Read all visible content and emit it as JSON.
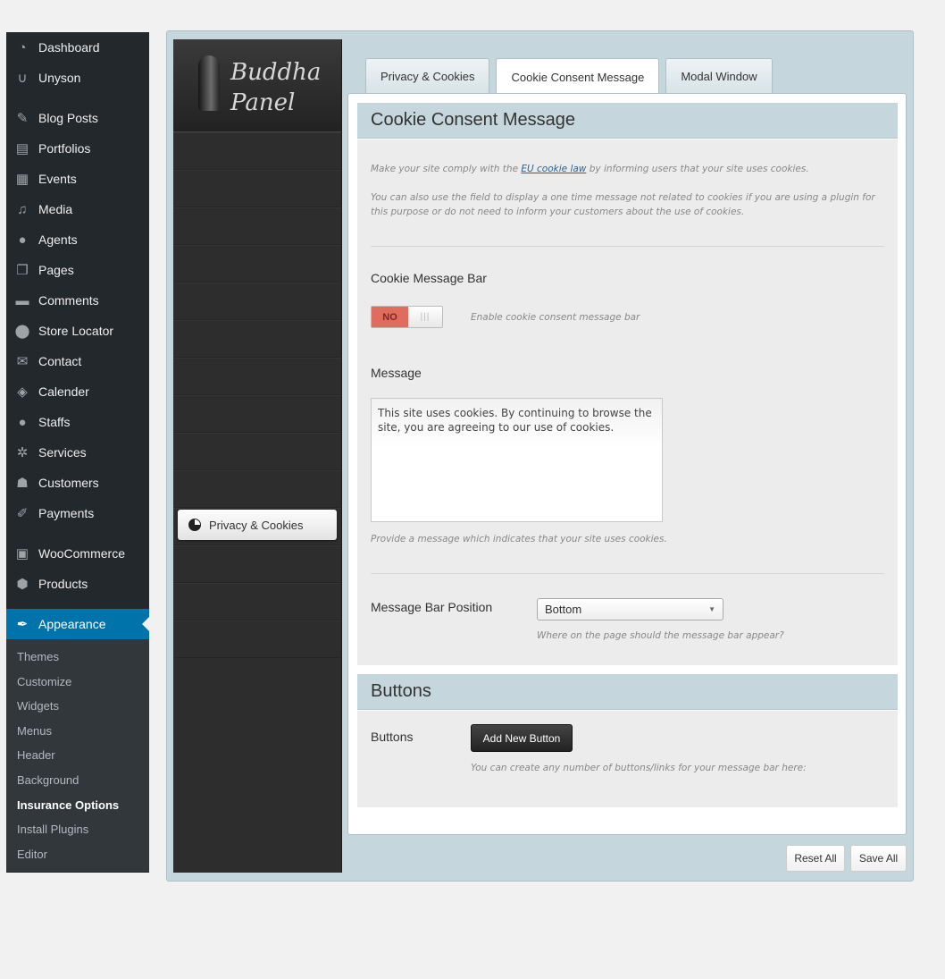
{
  "sidebar": {
    "items": [
      {
        "label": "Dashboard",
        "icon": "gauge-icon"
      },
      {
        "label": "Unyson",
        "icon": "unyson-icon"
      },
      {
        "label": "Blog Posts",
        "icon": "pin-icon"
      },
      {
        "label": "Portfolios",
        "icon": "portfolio-icon"
      },
      {
        "label": "Events",
        "icon": "calendar-icon"
      },
      {
        "label": "Media",
        "icon": "media-icon"
      },
      {
        "label": "Agents",
        "icon": "person-icon"
      },
      {
        "label": "Pages",
        "icon": "pages-icon"
      },
      {
        "label": "Comments",
        "icon": "comment-icon"
      },
      {
        "label": "Store Locator",
        "icon": "location-icon"
      },
      {
        "label": "Contact",
        "icon": "mail-icon"
      },
      {
        "label": "Calender",
        "icon": "tag-icon"
      },
      {
        "label": "Staffs",
        "icon": "person-icon"
      },
      {
        "label": "Services",
        "icon": "services-icon"
      },
      {
        "label": "Customers",
        "icon": "group-icon"
      },
      {
        "label": "Payments",
        "icon": "edit-icon"
      },
      {
        "label": "WooCommerce",
        "icon": "woo-icon"
      },
      {
        "label": "Products",
        "icon": "box-icon"
      },
      {
        "label": "Appearance",
        "icon": "brush-icon"
      }
    ],
    "submenu": [
      "Themes",
      "Customize",
      "Widgets",
      "Menus",
      "Header",
      "Background",
      "Insurance Options",
      "Install Plugins",
      "Editor"
    ],
    "current_submenu": "Insurance Options"
  },
  "panel": {
    "logo_line1": "Buddha",
    "logo_line2": "Panel",
    "side_button": "Privacy & Cookies"
  },
  "tabs": [
    {
      "label": "Privacy & Cookies",
      "active": false
    },
    {
      "label": "Cookie Consent Message",
      "active": true
    },
    {
      "label": "Modal Window",
      "active": false
    }
  ],
  "section1": {
    "title": "Cookie Consent Message",
    "desc_pre": "Make your site comply with the ",
    "desc_link": "EU cookie law",
    "desc_post": " by informing users that your site uses cookies.",
    "desc2": "You can also use the field to display a one time message not related to cookies if you are using a plugin for this purpose or do not need to inform your customers about the use of cookies.",
    "bar_label": "Cookie Message Bar",
    "toggle_value": "NO",
    "toggle_desc": "Enable cookie consent message bar",
    "message_label": "Message",
    "message_value": "This site uses cookies. By continuing to browse the site, you are agreeing to our use of cookies.",
    "message_help": "Provide a message which indicates that your site uses cookies.",
    "position_label": "Message Bar Position",
    "position_value": "Bottom",
    "position_help": "Where on the page should the message bar appear?"
  },
  "section2": {
    "title": "Buttons",
    "label": "Buttons",
    "add_button": "Add New Button",
    "help": "You can create any number of buttons/links for your message bar here:"
  },
  "footer": {
    "reset": "Reset All",
    "save": "Save All"
  }
}
